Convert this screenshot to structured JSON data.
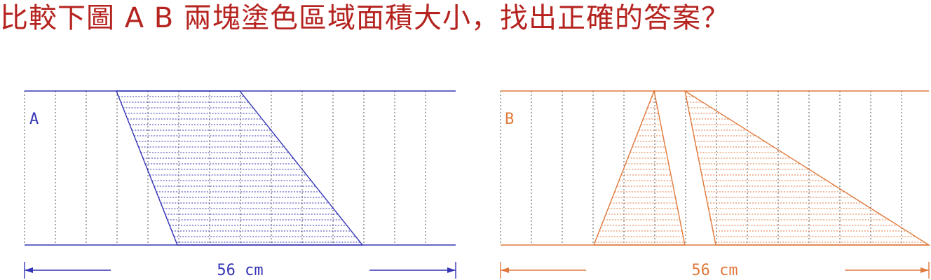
{
  "question": "比較下圖 A B 兩塊塗色區域面積大小，找出正確的答案？",
  "figures": [
    {
      "id": "A",
      "label": "A",
      "width_label": "56 cm",
      "color": "#3535b5",
      "shape": "parallelogram"
    },
    {
      "id": "B",
      "label": "B",
      "width_label": "56 cm",
      "color": "#e07a3c",
      "shape": "two-triangles"
    }
  ],
  "colors": {
    "title": "#b5231f",
    "figure_a": "#3535b5",
    "figure_b": "#e07a3c"
  }
}
